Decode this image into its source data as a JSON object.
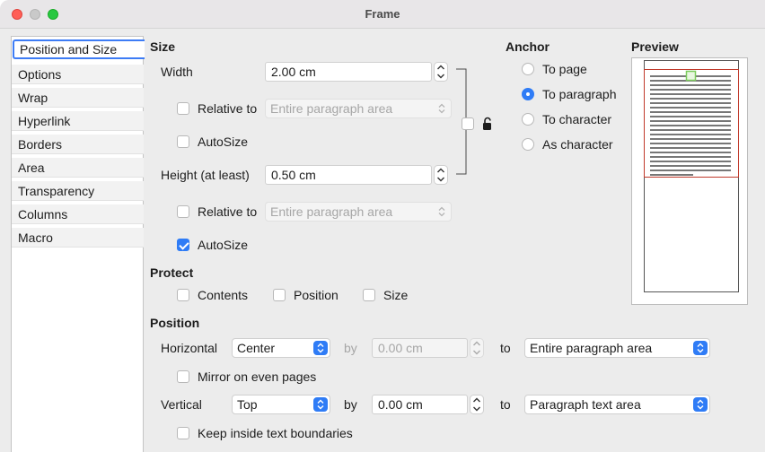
{
  "window": {
    "title": "Frame"
  },
  "sidebar": {
    "items": [
      {
        "label": "Position and Size"
      },
      {
        "label": "Options"
      },
      {
        "label": "Wrap"
      },
      {
        "label": "Hyperlink"
      },
      {
        "label": "Borders"
      },
      {
        "label": "Area"
      },
      {
        "label": "Transparency"
      },
      {
        "label": "Columns"
      },
      {
        "label": "Macro"
      }
    ],
    "selected": "Position and Size"
  },
  "size": {
    "heading": "Size",
    "width_label": "Width",
    "width_value": "2.00 cm",
    "relative_to_label": "Relative to",
    "relative_width_value": "Entire paragraph area",
    "autosize_label": "AutoSize",
    "height_label": "Height (at least)",
    "height_value": "0.50 cm",
    "relative_height_value": "Entire paragraph area",
    "autosize_height_label": "AutoSize"
  },
  "anchor": {
    "heading": "Anchor",
    "options": [
      {
        "label": "To page",
        "selected": false
      },
      {
        "label": "To paragraph",
        "selected": true
      },
      {
        "label": "To character",
        "selected": false
      },
      {
        "label": "As character",
        "selected": false
      }
    ]
  },
  "preview": {
    "heading": "Preview"
  },
  "protect": {
    "heading": "Protect",
    "contents_label": "Contents",
    "position_label": "Position",
    "size_label": "Size"
  },
  "position": {
    "heading": "Position",
    "horizontal_label": "Horizontal",
    "horizontal_value": "Center",
    "by_label": "by",
    "horizontal_by_value": "0.00 cm",
    "to_label": "to",
    "horizontal_to_value": "Entire paragraph area",
    "mirror_label": "Mirror on even pages",
    "vertical_label": "Vertical",
    "vertical_value": "Top",
    "vertical_by_value": "0.00 cm",
    "vertical_to_value": "Paragraph text area",
    "keep_inside_label": "Keep inside text boundaries"
  },
  "colors": {
    "accent": "#2f7cf6",
    "preview_frame": "#c0392b",
    "preview_anchor": "#7ccc5c"
  }
}
